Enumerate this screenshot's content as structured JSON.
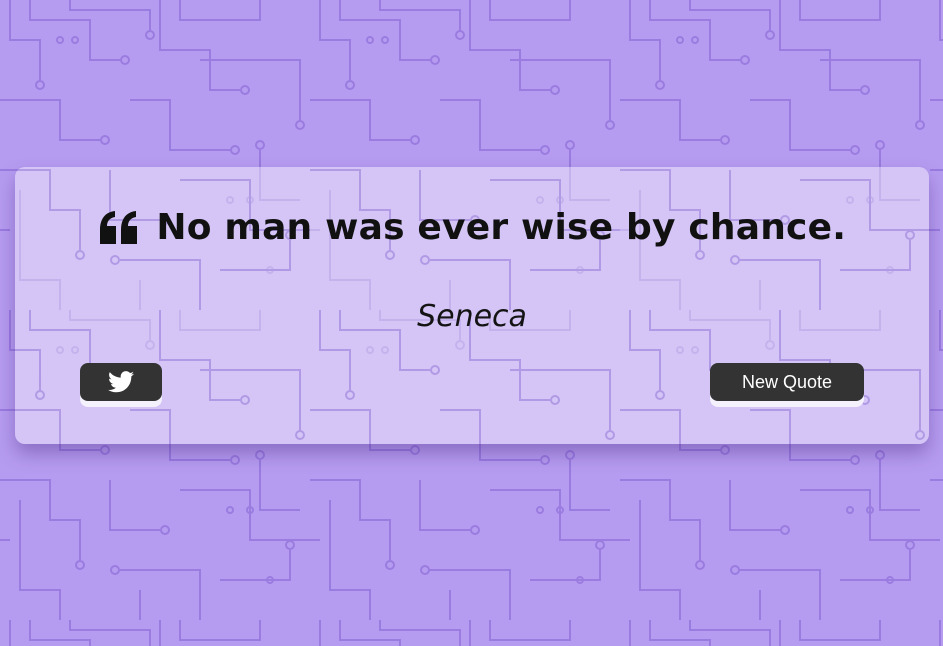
{
  "quote": {
    "text": "No man was ever wise by chance.",
    "author": "Seneca",
    "icon": "quote-left-icon"
  },
  "buttons": {
    "tweet_icon": "twitter-icon",
    "new_quote_label": "New Quote"
  },
  "colors": {
    "background": "#b69cf0",
    "circuit_lines": "#9a7be0",
    "button": "#333333",
    "button_text": "#ffffff"
  }
}
